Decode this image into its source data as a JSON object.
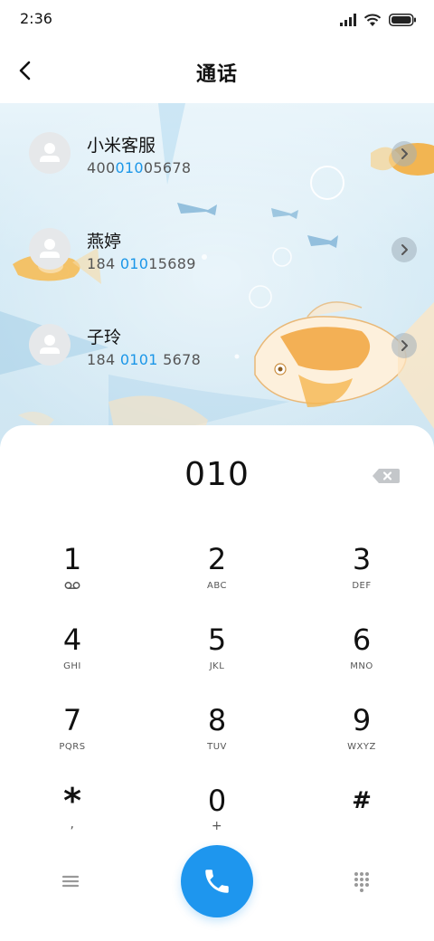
{
  "status_bar": {
    "time": "2:36"
  },
  "header": {
    "title": "通话"
  },
  "contacts": [
    {
      "name": "小米客服",
      "number_parts": [
        "400",
        "010",
        "05678"
      ]
    },
    {
      "name": "燕婷",
      "number_parts": [
        "184 ",
        "010",
        "15689"
      ]
    },
    {
      "name": "子玲",
      "number_parts": [
        "184 ",
        "0101",
        " 5678"
      ]
    }
  ],
  "dialer": {
    "input": "010",
    "keys": [
      {
        "digit": "1",
        "letters": ""
      },
      {
        "digit": "2",
        "letters": "ABC"
      },
      {
        "digit": "3",
        "letters": "DEF"
      },
      {
        "digit": "4",
        "letters": "GHI"
      },
      {
        "digit": "5",
        "letters": "JKL"
      },
      {
        "digit": "6",
        "letters": "MNO"
      },
      {
        "digit": "7",
        "letters": "PQRS"
      },
      {
        "digit": "8",
        "letters": "TUV"
      },
      {
        "digit": "9",
        "letters": "WXYZ"
      },
      {
        "digit": "*",
        "letters": ","
      },
      {
        "digit": "0",
        "letters": "+"
      },
      {
        "digit": "#",
        "letters": ""
      }
    ]
  },
  "icons": {
    "voicemail": "voicemail-icon",
    "backspace": "backspace-icon",
    "call": "phone-icon",
    "menu": "menu-icon",
    "keypad": "dialpad-icon"
  },
  "colors": {
    "accent": "#1e96ee",
    "highlight": "#1a96e8"
  }
}
